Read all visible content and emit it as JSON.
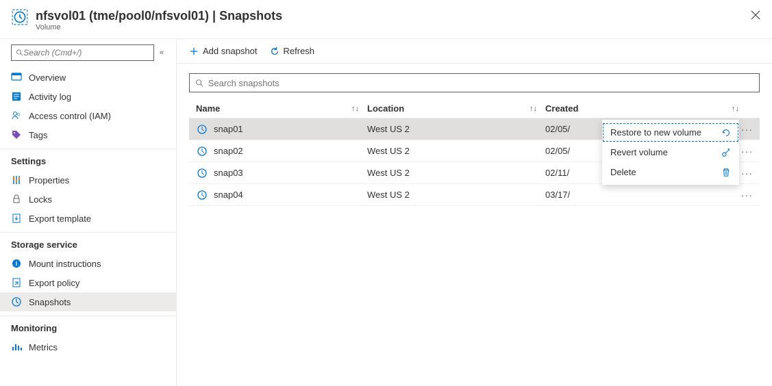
{
  "header": {
    "title": "nfsvol01 (tme/pool0/nfsvol01) | Snapshots",
    "subtitle": "Volume"
  },
  "sidebar": {
    "search_placeholder": "Search (Cmd+/)",
    "groups": [
      {
        "header": null,
        "items": [
          {
            "label": "Overview",
            "icon": "overview"
          },
          {
            "label": "Activity log",
            "icon": "activity-log"
          },
          {
            "label": "Access control (IAM)",
            "icon": "access-control"
          },
          {
            "label": "Tags",
            "icon": "tags"
          }
        ]
      },
      {
        "header": "Settings",
        "items": [
          {
            "label": "Properties",
            "icon": "properties"
          },
          {
            "label": "Locks",
            "icon": "locks"
          },
          {
            "label": "Export template",
            "icon": "export-template"
          }
        ]
      },
      {
        "header": "Storage service",
        "items": [
          {
            "label": "Mount instructions",
            "icon": "mount"
          },
          {
            "label": "Export policy",
            "icon": "export-policy"
          },
          {
            "label": "Snapshots",
            "icon": "snapshots",
            "selected": true
          }
        ]
      },
      {
        "header": "Monitoring",
        "items": [
          {
            "label": "Metrics",
            "icon": "metrics"
          }
        ]
      }
    ]
  },
  "toolbar": {
    "add_label": "Add snapshot",
    "refresh_label": "Refresh"
  },
  "content": {
    "search_placeholder": "Search snapshots",
    "columns": {
      "name": "Name",
      "location": "Location",
      "created": "Created"
    },
    "rows": [
      {
        "name": "snap01",
        "location": "West US 2",
        "created": "02/05/"
      },
      {
        "name": "snap02",
        "location": "West US 2",
        "created": "02/05/"
      },
      {
        "name": "snap03",
        "location": "West US 2",
        "created": "02/11/"
      },
      {
        "name": "snap04",
        "location": "West US 2",
        "created": "03/17/"
      }
    ]
  },
  "context_menu": {
    "restore": "Restore to new volume",
    "revert": "Revert volume",
    "delete": "Delete"
  }
}
